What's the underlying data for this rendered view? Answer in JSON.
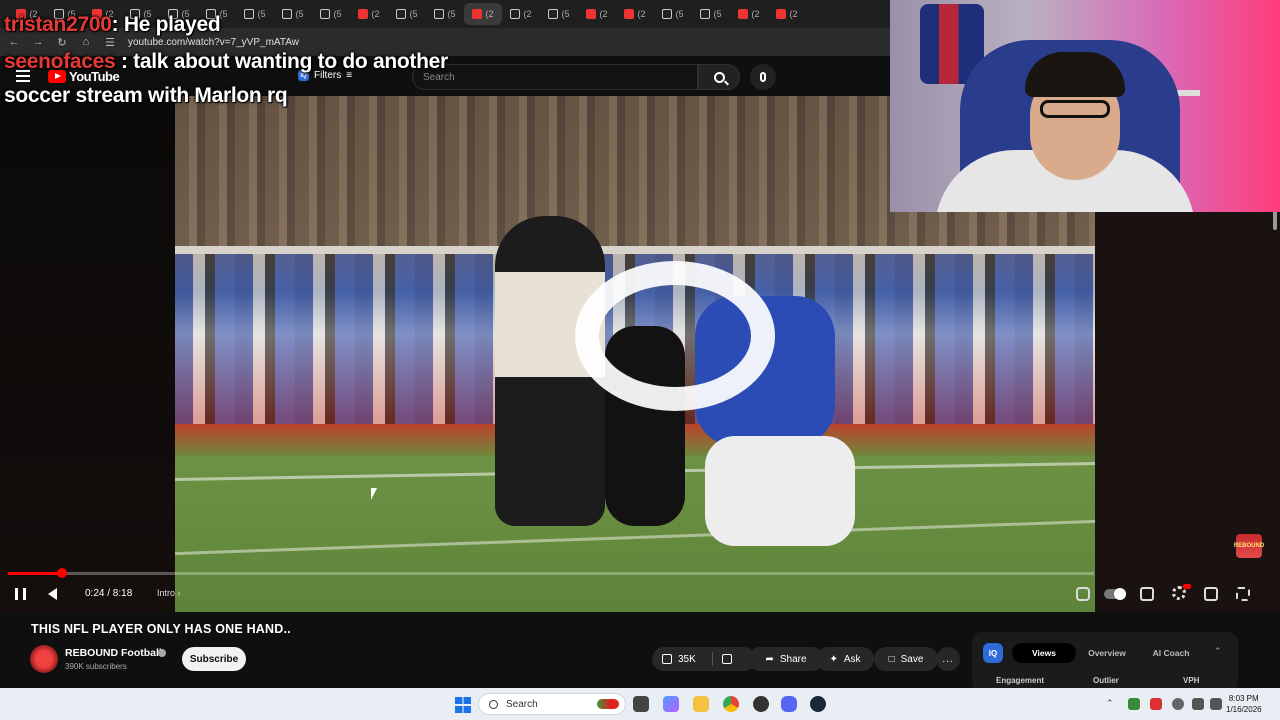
{
  "chat": {
    "line1_user": "tristan2700",
    "line1_sep": ": ",
    "line1_text": "He played",
    "line2_user": "seenofaces",
    "line2_sep": " : ",
    "line2_text": "talk about wanting to do another",
    "line3_text": "soccer stream with Marlon rq"
  },
  "browser": {
    "url": "youtube.com/watch?v=7_yVP_mATAw",
    "tab_labels": [
      "(2",
      "(5",
      "(2",
      "(5",
      "(5",
      "(5",
      "(5",
      "(5",
      "(5",
      "(2",
      "(5",
      "(5",
      "(2",
      "(2",
      "(5",
      "(2",
      "(2",
      "(5",
      "(5",
      "(2",
      "(2"
    ]
  },
  "masthead": {
    "logo": "YouTube",
    "filters": "Filters",
    "search_placeholder": "Search",
    "iq_mini": "IQ"
  },
  "player": {
    "time": "0:24 / 8:18",
    "chapter": "Intro",
    "progress_fraction": 0.05,
    "corner_badge": "REBOUND"
  },
  "video": {
    "title": "THIS NFL PLAYER ONLY HAS ONE HAND..",
    "channel_name": "REBOUND Football",
    "subscribers": "390K subscribers",
    "subscribe_label": "Subscribe",
    "likes": "35K",
    "share_label": "Share",
    "ask_label": "Ask",
    "save_label": "Save",
    "more_label": "..."
  },
  "iq_panel": {
    "logo": "IQ",
    "tabs": [
      "Views",
      "Overview",
      "AI Coach"
    ],
    "subheads": [
      "Engagement",
      "Outlier",
      "VPH"
    ]
  },
  "taskbar": {
    "search_label": "Search",
    "time": "8:03 PM",
    "date": "1/16/2026"
  },
  "colors": {
    "youtube_red": "#ff0000",
    "chat_user": "#e53935",
    "iq_blue": "#2e6bd8"
  }
}
